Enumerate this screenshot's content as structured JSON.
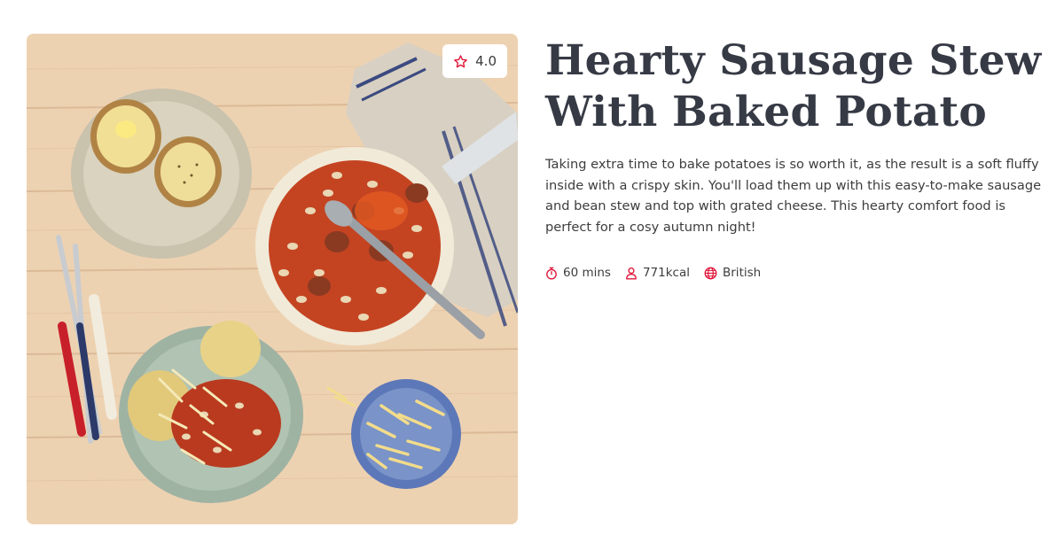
{
  "recipe": {
    "title": "Hearty Sausage Stew With Baked Potato",
    "description": "Taking extra time to bake potatoes is so worth it, as the result is a soft fluffy inside with a crispy skin. You'll load them up with this easy-to-make sausage and bean stew and top with grated cheese. This hearty comfort food is perfect for a cosy autumn night!",
    "rating": "4.0",
    "meta": {
      "time": "60 mins",
      "calories": "771kcal",
      "cuisine": "British"
    }
  },
  "icons": {
    "rating": "star-icon",
    "time": "stopwatch-icon",
    "calories": "person-icon",
    "cuisine": "globe-icon"
  },
  "colors": {
    "accent": "#e0193c",
    "title": "#363a45",
    "text": "#3d3d3d"
  }
}
